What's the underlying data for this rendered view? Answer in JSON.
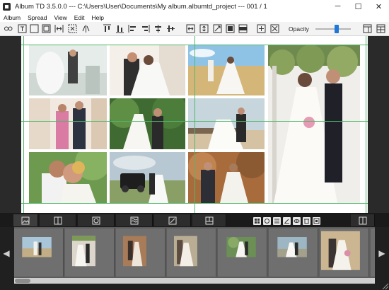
{
  "window": {
    "title": "Album TD 3.5.0.0 --- C:\\Users\\User\\Documents\\My album.albumtd_project --- 001 / 1",
    "controls": {
      "minimize": "─",
      "maximize": "☐",
      "close": "✕"
    }
  },
  "menu": [
    "Album",
    "Spread",
    "View",
    "Edit",
    "Help"
  ],
  "toolbar": {
    "opacity_label": "Opacity",
    "opacity_value": 0.6,
    "icons": [
      "settings-icon",
      "text-frame-icon",
      "image-frame-icon",
      "frame-fill-icon",
      "fit-width-icon",
      "fit-page-icon",
      "mirror-icon",
      "align-top-icon",
      "align-bottom-icon",
      "align-left-icon",
      "align-right-icon",
      "align-center-h-icon",
      "align-center-v-icon",
      "stretch-width-icon",
      "stretch-height-icon",
      "fit-diagonal-icon",
      "stretch-both-icon",
      "fill-frame-icon",
      "add-frame-icon",
      "delete-frame-icon",
      "grid-icon",
      "panel-icon"
    ]
  },
  "panel": {
    "tabs": [
      "photos-tab-icon",
      "layouts-tab-icon",
      "backgrounds-tab-icon",
      "textures-tab-icon",
      "cliparts-tab-icon",
      "templates-tab-icon",
      "spreads-tab-icon"
    ],
    "tools": [
      "select-all-icon",
      "rotate-icon",
      "filter-icon",
      "rename-icon",
      "preview-icon",
      "delete-icon",
      "settings-icon"
    ],
    "arrows": {
      "left": "◀",
      "right": "▶"
    },
    "thumbnails": 9
  },
  "colors": {
    "guide": "#4fb86b",
    "accent": "#1e78d7",
    "canvas_bg": "#2a2a2a",
    "panel_bg": "#202020"
  }
}
